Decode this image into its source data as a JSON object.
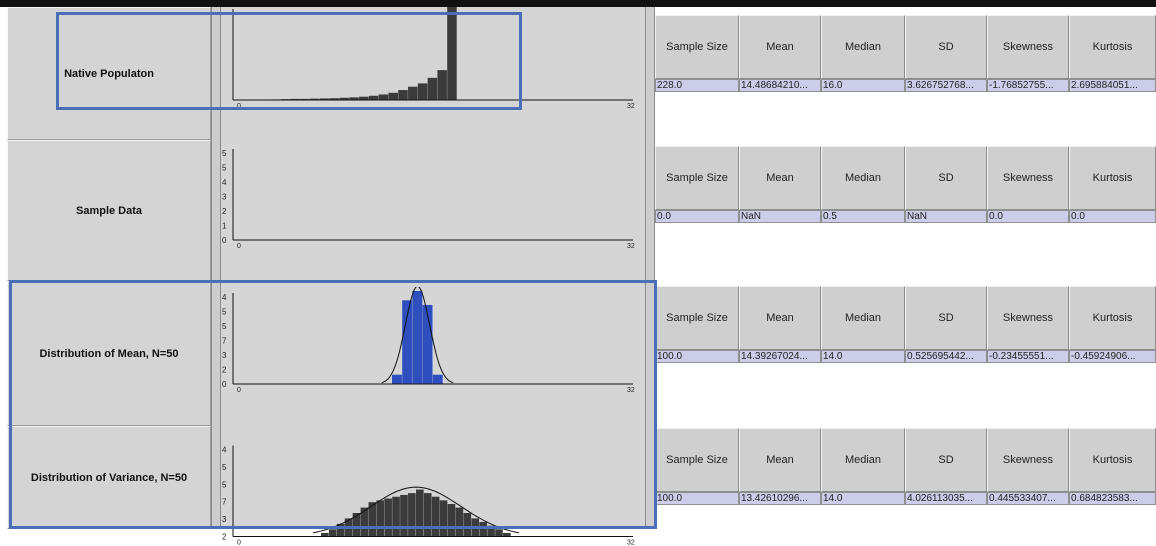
{
  "accent_color": "#4a6fb8",
  "table_headers": [
    "Sample Size",
    "Mean",
    "Median",
    "SD",
    "Skewness",
    "Kurtosis"
  ],
  "rows": [
    {
      "label": "Native Populaton",
      "stats": [
        "228.0",
        "14.48684210...",
        "16.0",
        "3.626752768...",
        "-1.76852755...",
        "2.695884051..."
      ],
      "chart_data": {
        "type": "bar",
        "x_range": [
          0,
          32
        ],
        "tick_labels": [
          "0",
          "32"
        ],
        "y_tick_labels": [],
        "bar_color": "#3b3b3b",
        "values": [
          0.5,
          0.8,
          1,
          1,
          1.2,
          1.4,
          1.6,
          2,
          2.4,
          3,
          3.8,
          5,
          6.5,
          9,
          12,
          15,
          20,
          27,
          84
        ]
      }
    },
    {
      "label": "Sample Data",
      "stats": [
        "0.0",
        "NaN",
        "0.5",
        "NaN",
        "0.0",
        "0.0"
      ],
      "chart_data": {
        "type": "bar",
        "x_range": [
          0,
          32
        ],
        "tick_labels": [
          "0",
          "32"
        ],
        "y_tick_labels": [
          "5",
          "5",
          "4",
          "3",
          "2",
          "1",
          "0"
        ],
        "values": []
      }
    },
    {
      "label": "Distribution of Mean, N=50",
      "stats": [
        "100.0",
        "14.39267024...",
        "14.0",
        "0.525695442...",
        "-0.23455551...",
        "-0.45924906..."
      ],
      "chart_data": {
        "type": "bar",
        "x_range": [
          0,
          32
        ],
        "tick_labels": [
          "0",
          "32"
        ],
        "y_tick_labels": [
          "4",
          "5",
          "5",
          "7",
          "3",
          "2",
          "0"
        ],
        "bar_color": "#2f4fbf",
        "values": [
          0.1,
          0.9,
          1.0,
          0.85,
          0.1
        ],
        "curve": true
      }
    },
    {
      "label": "Distribution of Variance, N=50",
      "stats": [
        "100.0",
        "13.42610296...",
        "14.0",
        "4.026113035...",
        "0.445533407...",
        "0.684823583..."
      ],
      "chart_data": {
        "type": "bar",
        "x_range": [
          0,
          32
        ],
        "tick_labels": [
          "0",
          "32"
        ],
        "y_tick_labels": [
          "4",
          "5",
          "5",
          "7",
          "3",
          "2"
        ],
        "bar_color": "#3b3b3b",
        "values": [
          1,
          2,
          3.5,
          5,
          6.5,
          8,
          9.5,
          10,
          10.5,
          11,
          11.5,
          12,
          13,
          12,
          11,
          10,
          9,
          8,
          6.5,
          5,
          4,
          3,
          2,
          1
        ],
        "curve": true
      }
    }
  ]
}
